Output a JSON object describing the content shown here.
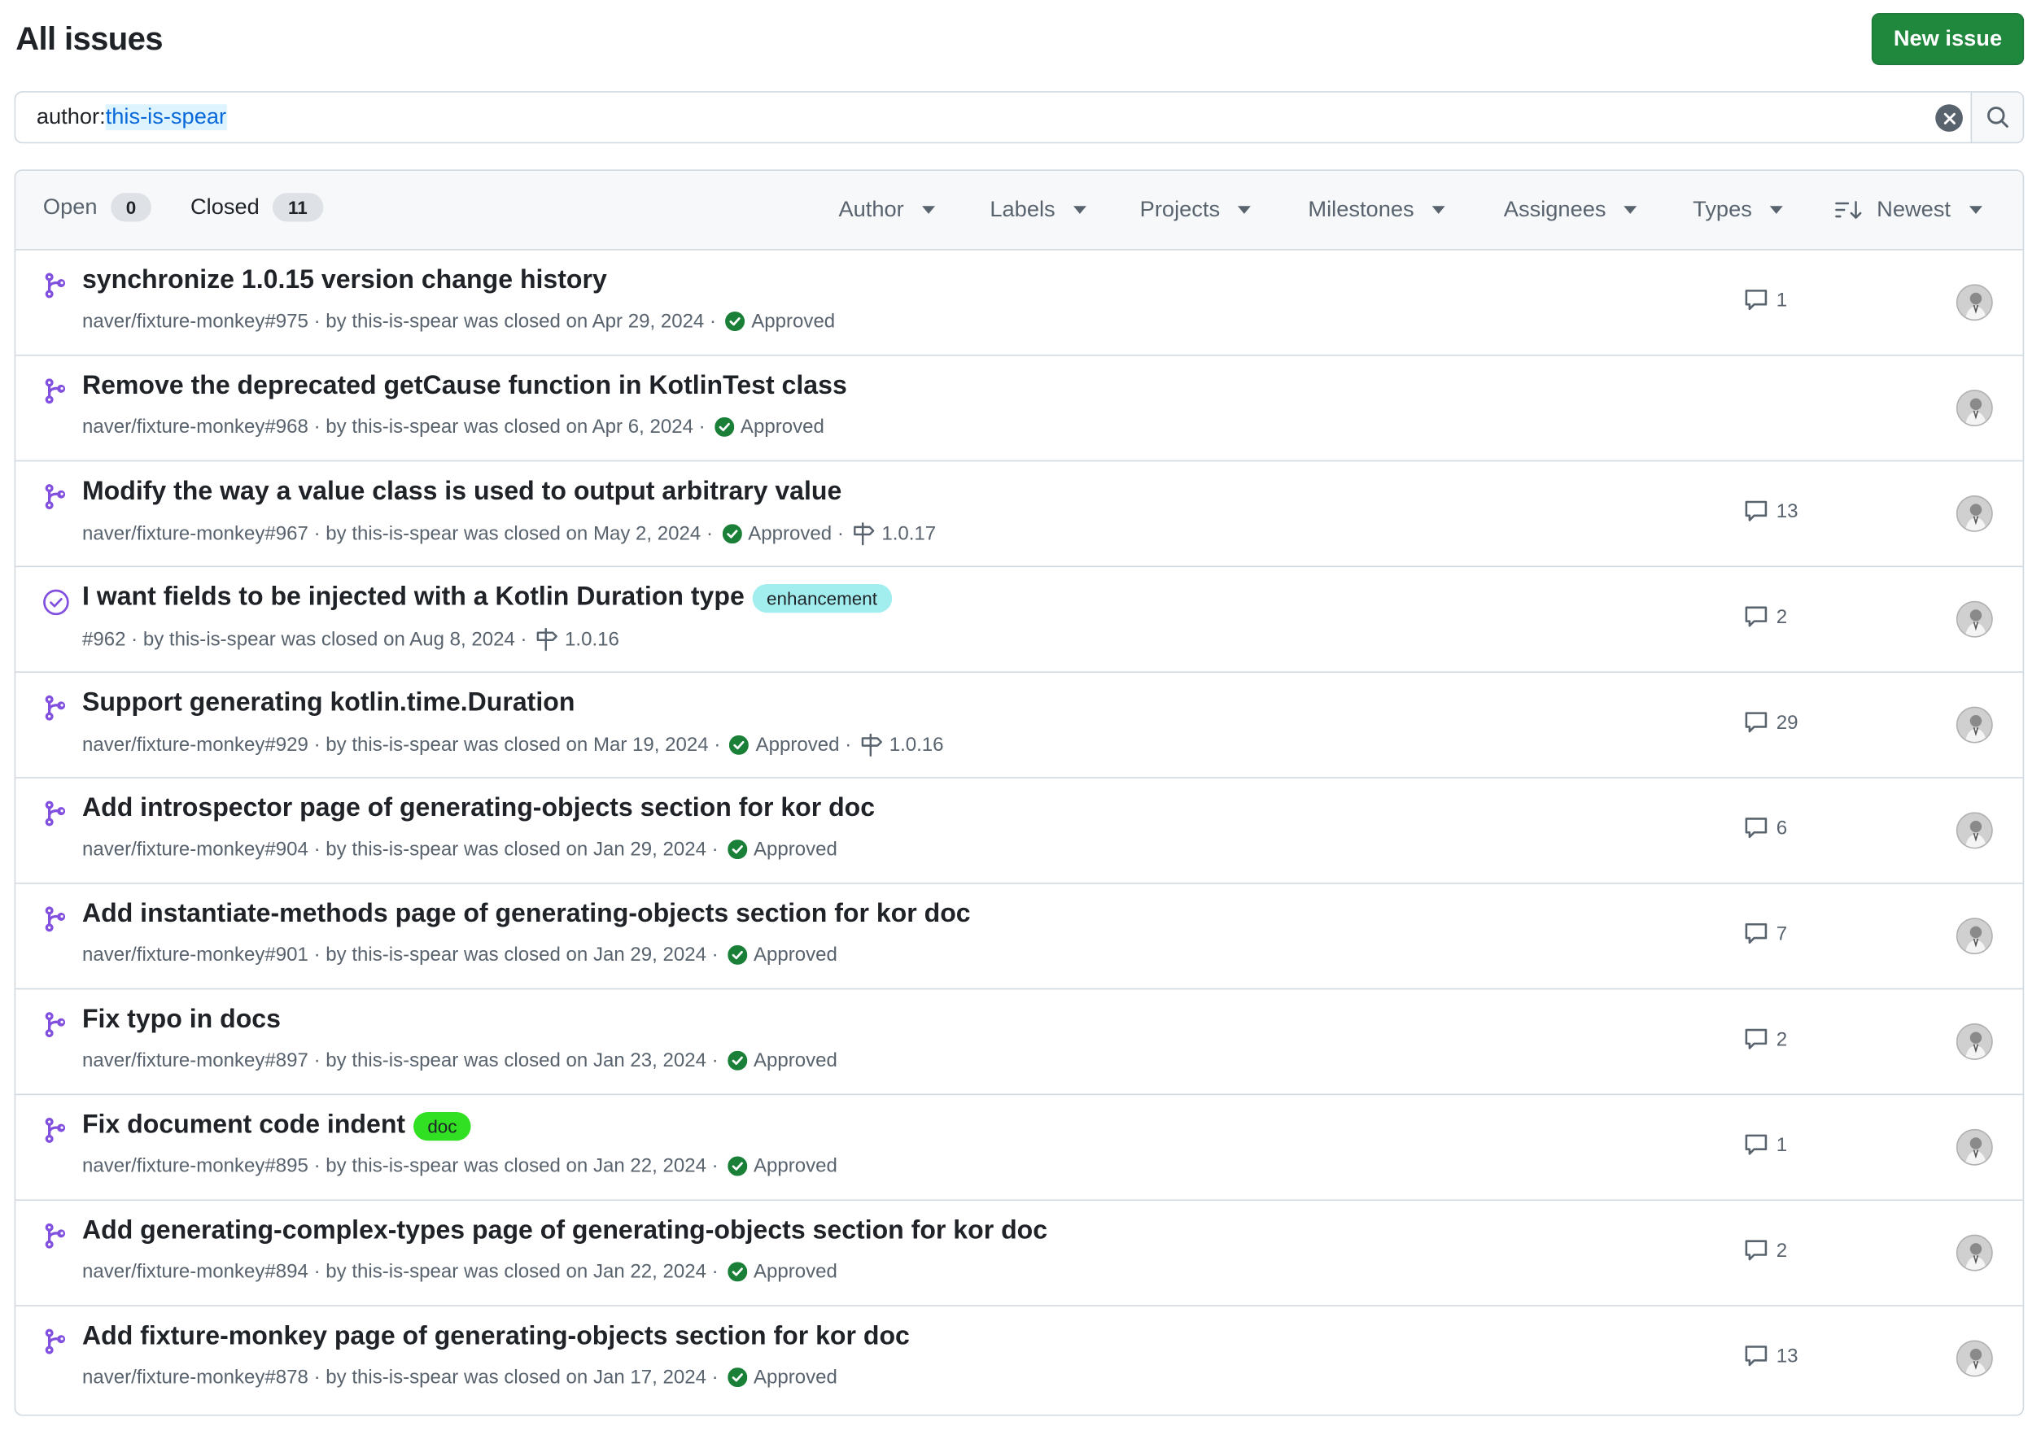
{
  "page": {
    "title": "All issues",
    "new_issue_label": "New issue"
  },
  "search": {
    "qualifier_key": "author:",
    "qualifier_value": "this-is-spear"
  },
  "tabs": {
    "open_label": "Open",
    "open_count": "0",
    "closed_label": "Closed",
    "closed_count": "11"
  },
  "filters": {
    "author": "Author",
    "labels": "Labels",
    "projects": "Projects",
    "milestones": "Milestones",
    "assignees": "Assignees",
    "types": "Types",
    "sort": "Newest"
  },
  "colors": {
    "pr_icon": "#8250df",
    "approved": "#1a7f37",
    "enhancement_bg": "#a2eeef",
    "doc_bg": "#31e023",
    "primary_button": "#1f883d"
  },
  "issues": [
    {
      "type": "pr",
      "title": "synchronize 1.0.15 version change history",
      "label": null,
      "ref": "naver/fixture-monkey#975",
      "by": "by this-is-spear was closed on Apr 29, 2024",
      "review": "Approved",
      "milestone": null,
      "comments": "1"
    },
    {
      "type": "pr",
      "title": "Remove the deprecated getCause function in KotlinTest class",
      "label": null,
      "ref": "naver/fixture-monkey#968",
      "by": "by this-is-spear was closed on Apr 6, 2024",
      "review": "Approved",
      "milestone": null,
      "comments": null
    },
    {
      "type": "pr",
      "title": "Modify the way a value class is used to output arbitrary value",
      "label": null,
      "ref": "naver/fixture-monkey#967",
      "by": "by this-is-spear was closed on May 2, 2024",
      "review": "Approved",
      "milestone": "1.0.17",
      "comments": "13"
    },
    {
      "type": "issue",
      "title": "I want fields to be injected with a Kotlin Duration type",
      "label": "enhancement",
      "ref": "#962",
      "by": "by this-is-spear was closed on Aug 8, 2024",
      "review": null,
      "milestone": "1.0.16",
      "comments": "2"
    },
    {
      "type": "pr",
      "title": "Support generating kotlin.time.Duration",
      "label": null,
      "ref": "naver/fixture-monkey#929",
      "by": "by this-is-spear was closed on Mar 19, 2024",
      "review": "Approved",
      "milestone": "1.0.16",
      "comments": "29"
    },
    {
      "type": "pr",
      "title": "Add introspector page of generating-objects section for kor doc",
      "label": null,
      "ref": "naver/fixture-monkey#904",
      "by": "by this-is-spear was closed on Jan 29, 2024",
      "review": "Approved",
      "milestone": null,
      "comments": "6"
    },
    {
      "type": "pr",
      "title": "Add instantiate-methods page of generating-objects section for kor doc",
      "label": null,
      "ref": "naver/fixture-monkey#901",
      "by": "by this-is-spear was closed on Jan 29, 2024",
      "review": "Approved",
      "milestone": null,
      "comments": "7"
    },
    {
      "type": "pr",
      "title": "Fix typo in docs",
      "label": null,
      "ref": "naver/fixture-monkey#897",
      "by": "by this-is-spear was closed on Jan 23, 2024",
      "review": "Approved",
      "milestone": null,
      "comments": "2"
    },
    {
      "type": "pr",
      "title": "Fix document code indent",
      "label": "doc",
      "ref": "naver/fixture-monkey#895",
      "by": "by this-is-spear was closed on Jan 22, 2024",
      "review": "Approved",
      "milestone": null,
      "comments": "1"
    },
    {
      "type": "pr",
      "title": "Add generating-complex-types page of generating-objects section for kor doc",
      "label": null,
      "ref": "naver/fixture-monkey#894",
      "by": "by this-is-spear was closed on Jan 22, 2024",
      "review": "Approved",
      "milestone": null,
      "comments": "2"
    },
    {
      "type": "pr",
      "title": "Add fixture-monkey page of generating-objects section for kor doc",
      "label": null,
      "ref": "naver/fixture-monkey#878",
      "by": "by this-is-spear was closed on Jan 17, 2024",
      "review": "Approved",
      "milestone": null,
      "comments": "13"
    }
  ]
}
